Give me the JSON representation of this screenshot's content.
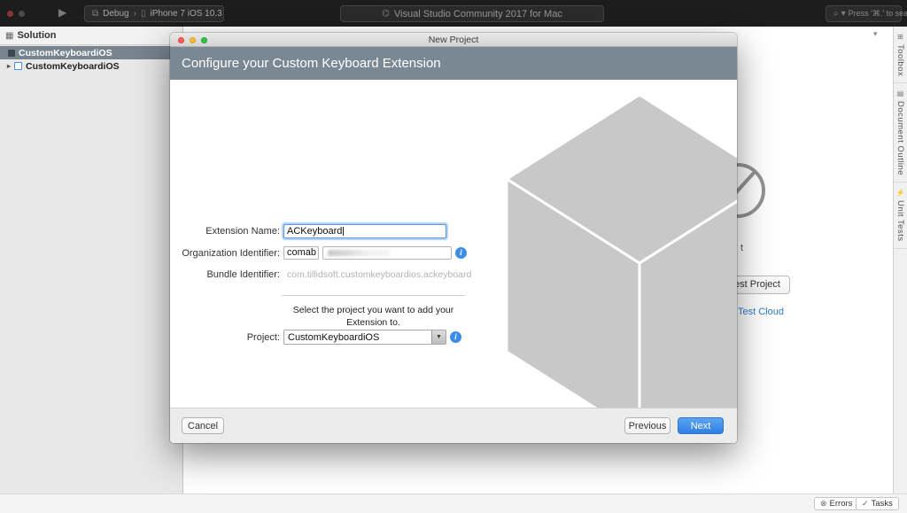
{
  "topbar": {
    "run_icon": "▶",
    "overlap_icon": "⧉",
    "config_label": "Debug",
    "chevron": "›",
    "phone_icon": "▯",
    "device_name": "iPhone 7 iOS 10.3",
    "title_icon": "⌬",
    "window_title": "Visual Studio Community 2017 for Mac",
    "search_icon": "⌕",
    "search_caret": "▾",
    "search_placeholder": "Press '⌘.' to search"
  },
  "sidebar": {
    "header": "Solution",
    "header_icon": "▦",
    "search_icon": "⌕",
    "items": [
      {
        "label": "CustomKeyboardiOS"
      },
      {
        "label": "CustomKeyboardiOS",
        "disclosure": "▸"
      }
    ]
  },
  "editor": {
    "dropdown_icon": "▾"
  },
  "right_tabs": [
    {
      "icon": "⊞",
      "label": "Toolbox"
    },
    {
      "icon": "▤",
      "label": "Document Outline"
    },
    {
      "icon": "⚡",
      "label": "Unit Tests"
    }
  ],
  "background": {
    "partial_text": "t",
    "partial_button": "est Project",
    "partial_link": "Test Cloud"
  },
  "dialog": {
    "window_title": "New Project",
    "header": "Configure your Custom Keyboard Extension",
    "form": {
      "extension_name_label": "Extension Name:",
      "extension_name_value": "ACKeyboard",
      "org_label": "Organization Identifier:",
      "org_value": "comab",
      "bundle_label": "Bundle Identifier:",
      "bundle_value": "com.tillidsoft.customkeyboardios.ackeyboard",
      "hint": "Select the project you want to add your Extension to.",
      "project_label": "Project:",
      "project_value": "CustomKeyboardiOS",
      "info_glyph": "i"
    },
    "buttons": {
      "cancel": "Cancel",
      "previous": "Previous",
      "next": "Next"
    }
  },
  "statusbar": {
    "errors_icon": "⊗",
    "errors": "Errors",
    "tasks_icon": "✓",
    "tasks": "Tasks"
  },
  "colors": {
    "accent_blue": "#3f8ef3",
    "header_slate": "#7a8894",
    "link_blue": "#2e7cd6"
  }
}
